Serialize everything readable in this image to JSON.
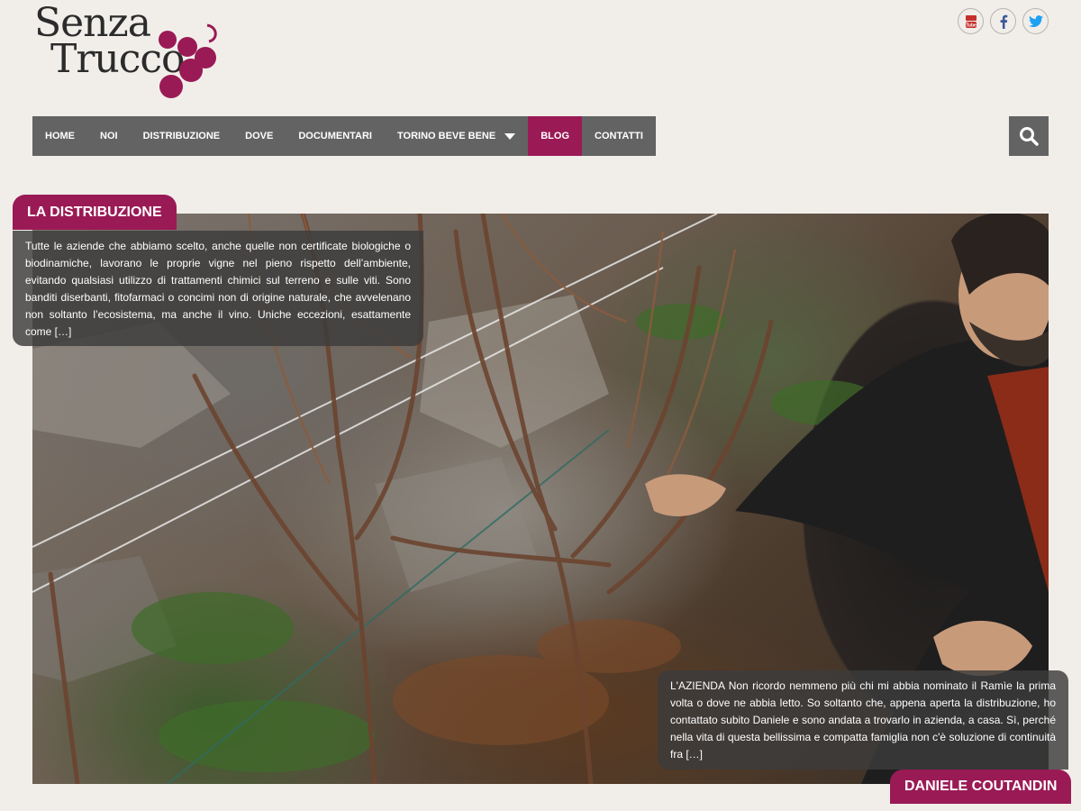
{
  "logo": {
    "line1": "Senza",
    "line2": "Trucco",
    "brand_color": "#9a1a55"
  },
  "social": [
    {
      "name": "youtube",
      "icon": "youtube-icon",
      "color": "#c4302b"
    },
    {
      "name": "facebook",
      "icon": "facebook-icon",
      "color": "#3b5998"
    },
    {
      "name": "twitter",
      "icon": "twitter-icon",
      "color": "#1da1f2"
    }
  ],
  "nav": {
    "items": [
      {
        "label": "HOME",
        "active": false,
        "has_dropdown": false
      },
      {
        "label": "NOI",
        "active": false,
        "has_dropdown": false
      },
      {
        "label": "DISTRIBUZIONE",
        "active": false,
        "has_dropdown": false
      },
      {
        "label": "DOVE",
        "active": false,
        "has_dropdown": false
      },
      {
        "label": "DOCUMENTARI",
        "active": false,
        "has_dropdown": false
      },
      {
        "label": "TORINO BEVE BENE",
        "active": false,
        "has_dropdown": true
      },
      {
        "label": "BLOG",
        "active": true,
        "has_dropdown": false
      },
      {
        "label": "CONTATTI",
        "active": false,
        "has_dropdown": false
      }
    ],
    "background": "#636363",
    "active_color": "#9a1a55",
    "search_icon": "search-icon"
  },
  "slides": {
    "left": {
      "title": "LA DISTRIBUZIONE",
      "text": "Tutte le aziende che abbiamo scelto, anche quelle non certificate biologiche o biodinamiche, lavorano le proprie vigne nel pieno rispetto dell’ambiente, evitando qualsiasi utilizzo di trattamenti chimici sul terreno e sulle viti. Sono banditi diserbanti, fitofarmaci o concimi non di origine naturale, che avvelenano non soltanto l’ecosistema, ma anche il vino. Uniche eccezioni, esattamente come […]"
    },
    "right": {
      "title": "DANIELE COUTANDIN",
      "text": "L'AZIENDA Non ricordo nemmeno più chi mi abbia nominato il Ramìe la prima volta o dove ne abbia letto. So soltanto che, appena aperta la distribuzione, ho contattato subito Daniele e sono andata a trovarlo in azienda, a casa. Sì, perché nella vita di questa bellissima e compatta famiglia non c'è soluzione di continuità fra […]"
    }
  }
}
